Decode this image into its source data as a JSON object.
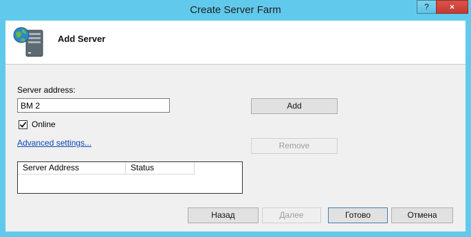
{
  "window": {
    "title": "Create Server Farm",
    "help_label": "?",
    "close_label": "×"
  },
  "header": {
    "title": "Add Server",
    "icon": "server-globe-icon"
  },
  "form": {
    "server_address_label": "Server address:",
    "server_address_value": "ВМ 2",
    "online_label": "Online",
    "online_checked": true,
    "advanced_link": "Advanced settings...",
    "add_button": "Add",
    "remove_button": "Remove"
  },
  "list": {
    "columns": [
      "Server Address",
      "Status"
    ]
  },
  "footer": {
    "back_button": "Назад",
    "next_button": "Далее",
    "finish_button": "Готово",
    "cancel_button": "Отмена"
  },
  "colors": {
    "frame": "#61c9ec",
    "close": "#c73a31",
    "link": "#0b44b8"
  }
}
